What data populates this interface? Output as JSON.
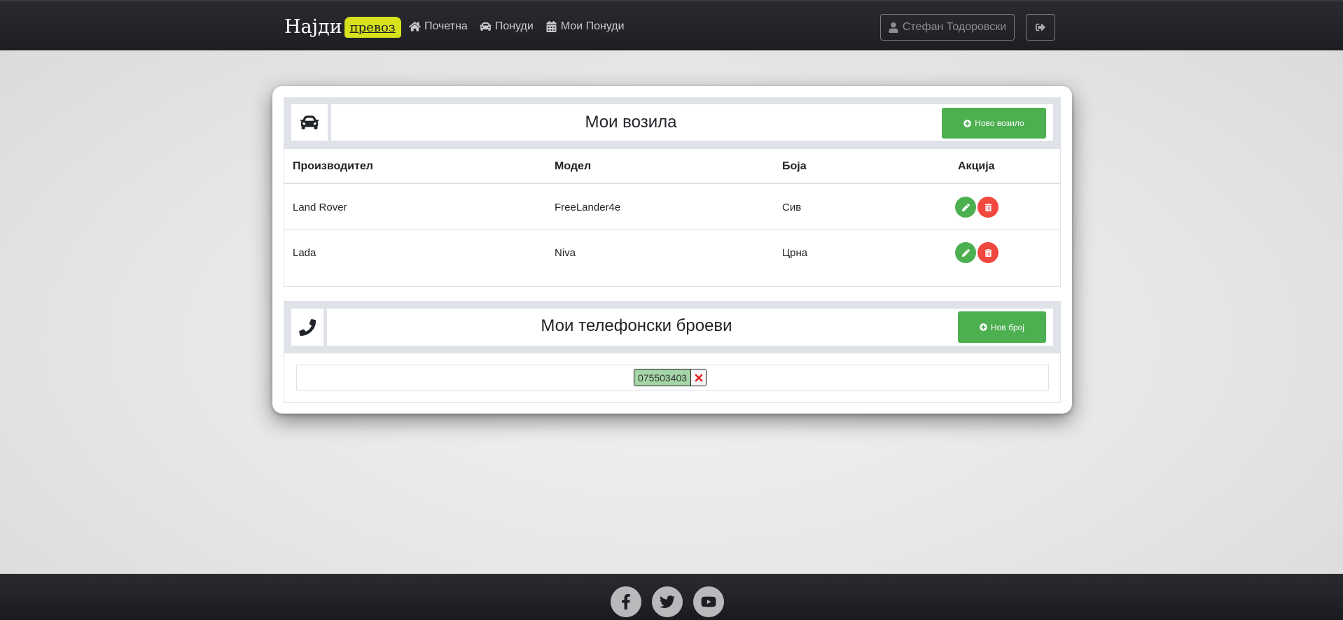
{
  "navbar": {
    "brand_text": "Најди",
    "brand_box_text": "превоз",
    "links": [
      {
        "label": "Почетна",
        "icon": "home-icon"
      },
      {
        "label": "Понуди",
        "icon": "car-icon"
      },
      {
        "label": "Мои Понуди",
        "icon": "calendar-icon"
      }
    ],
    "user_name": "Стефан Тодоровски",
    "logout_icon": "sign-out-icon"
  },
  "vehicles": {
    "title": "Мои возила",
    "add_button_label": "Ново возило",
    "columns": [
      "Производител",
      "Модел",
      "Боја",
      "Акција"
    ],
    "rows": [
      {
        "manufacturer": "Land Rover",
        "model": "FreeLander4e",
        "color": "Сив"
      },
      {
        "manufacturer": "Lada",
        "model": "Niva",
        "color": "Црна"
      }
    ]
  },
  "phones": {
    "title": "Мои телефонски броеви",
    "add_button_label": "Нов број",
    "numbers": [
      "075503403"
    ]
  },
  "footer": {
    "social": [
      "facebook-icon",
      "twitter-icon",
      "youtube-icon"
    ]
  },
  "colors": {
    "brand_accent": "#d7e21c",
    "success": "#4caf50",
    "danger": "#f0483e",
    "phone_chip": "#a5d6a7",
    "navbar": "#1d1e23"
  }
}
